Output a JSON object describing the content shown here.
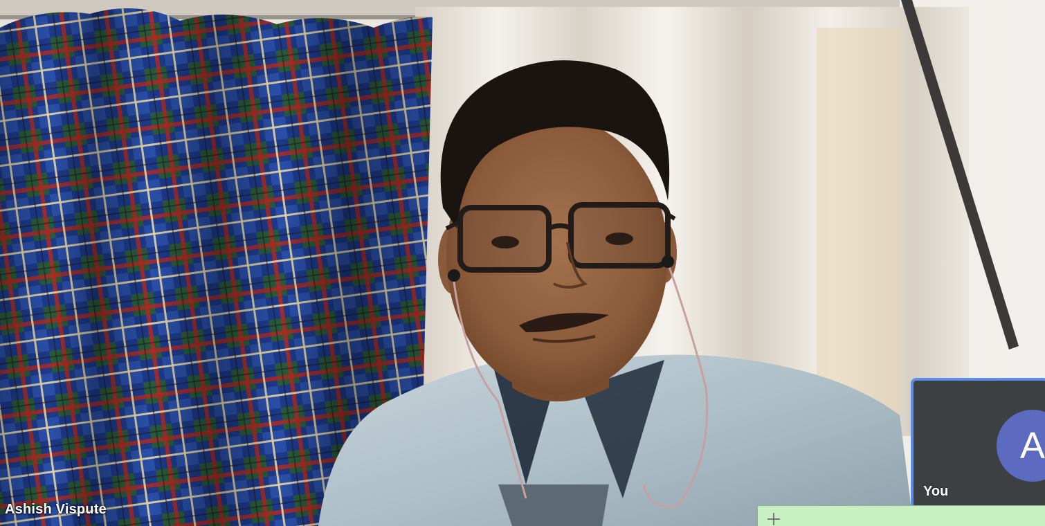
{
  "main_participant": {
    "name": "Ashish Vispute"
  },
  "self_view": {
    "avatar_initial": "A",
    "label": "You",
    "avatar_color": "#5c6bc0",
    "border_color": "#5b8de8"
  },
  "bottom_strip": {
    "icon": "plus-icon",
    "color": "#c9f0c3"
  }
}
